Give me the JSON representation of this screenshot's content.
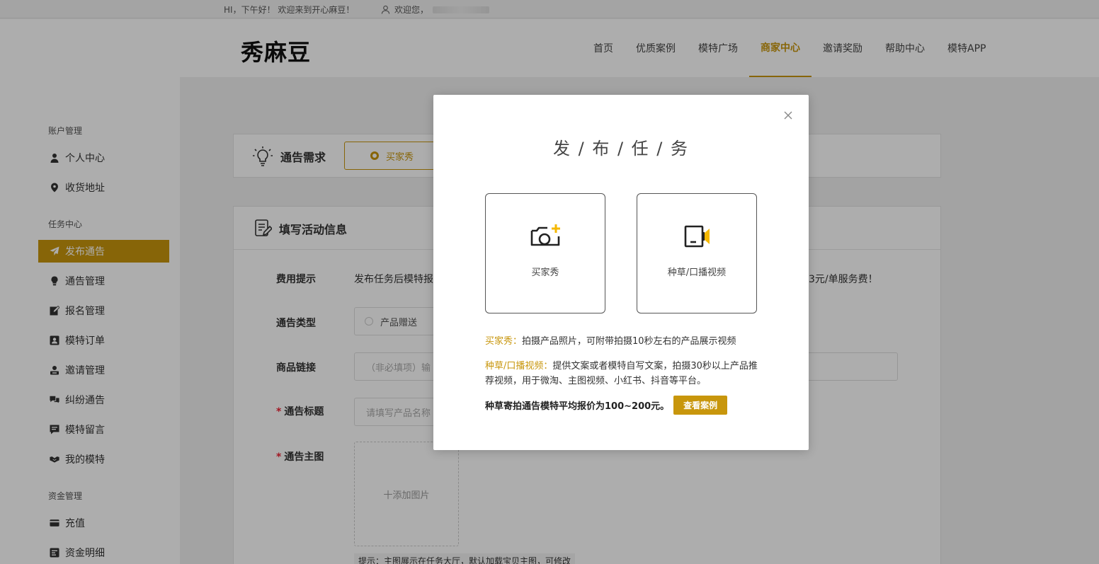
{
  "topbar": {
    "greeting": "HI，下午好！ 欢迎来到开心麻豆！",
    "welcome": "欢迎您，"
  },
  "header": {
    "logo": "秀麻豆",
    "nav": [
      {
        "label": "首页"
      },
      {
        "label": "优质案例"
      },
      {
        "label": "模特广场"
      },
      {
        "label": "商家中心"
      },
      {
        "label": "邀请奖励"
      },
      {
        "label": "帮助中心"
      },
      {
        "label": "模特APP"
      }
    ],
    "active_index": 3
  },
  "sidebar": {
    "groups": [
      {
        "title": "账户管理",
        "items": [
          "个人中心",
          "收货地址"
        ]
      },
      {
        "title": "任务中心",
        "items": [
          "发布通告",
          "通告管理",
          "报名管理",
          "模特订单",
          "邀请管理",
          "纠纷通告",
          "模特留言",
          "我的模特"
        ]
      },
      {
        "title": "资金管理",
        "items": [
          "充值",
          "资金明细"
        ]
      }
    ],
    "active_item": "发布通告"
  },
  "main": {
    "demand": {
      "title": "通告需求",
      "choice": "买家秀"
    },
    "form": {
      "title": "填写活动信息",
      "fee_label": "费用提示",
      "fee_text_left": "发布任务后模特报",
      "fee_text_right": "3元/单服务费！",
      "type_label": "通告类型",
      "type_option": "产品赠送",
      "link_label": "商品链接",
      "link_placeholder": "（非必填项）输",
      "title_label": "通告标题",
      "title_placeholder": "请填写产品名称",
      "image_label": "通告主图",
      "upload_text": "十添加图片",
      "image_tip": "提示：主图展示在任务大厅，默认加载宝贝主图，可修改"
    }
  },
  "modal": {
    "title": "发 / 布 / 任 / 务",
    "cards": [
      {
        "label": "买家秀",
        "icon": "camera-plus-icon"
      },
      {
        "label": "种草/口播视频",
        "icon": "video-speaker-icon"
      }
    ],
    "desc1_label": "买家秀：",
    "desc1_text": "拍摄产品照片，可附带拍摄10秒左右的产品展示视频",
    "desc2_label": "种草/口播视频：",
    "desc2_text": "提供文案或者模特自写文案，拍摄30秒以上产品推荐视频，用于微淘、主图视频、小红书、抖音等平台。",
    "note": "种草寄拍通告模特平均报价为100~200元。",
    "case_button": "查看案例"
  },
  "colors": {
    "accent": "#c8960c",
    "overlay": "rgba(0,0,0,0.32)"
  }
}
